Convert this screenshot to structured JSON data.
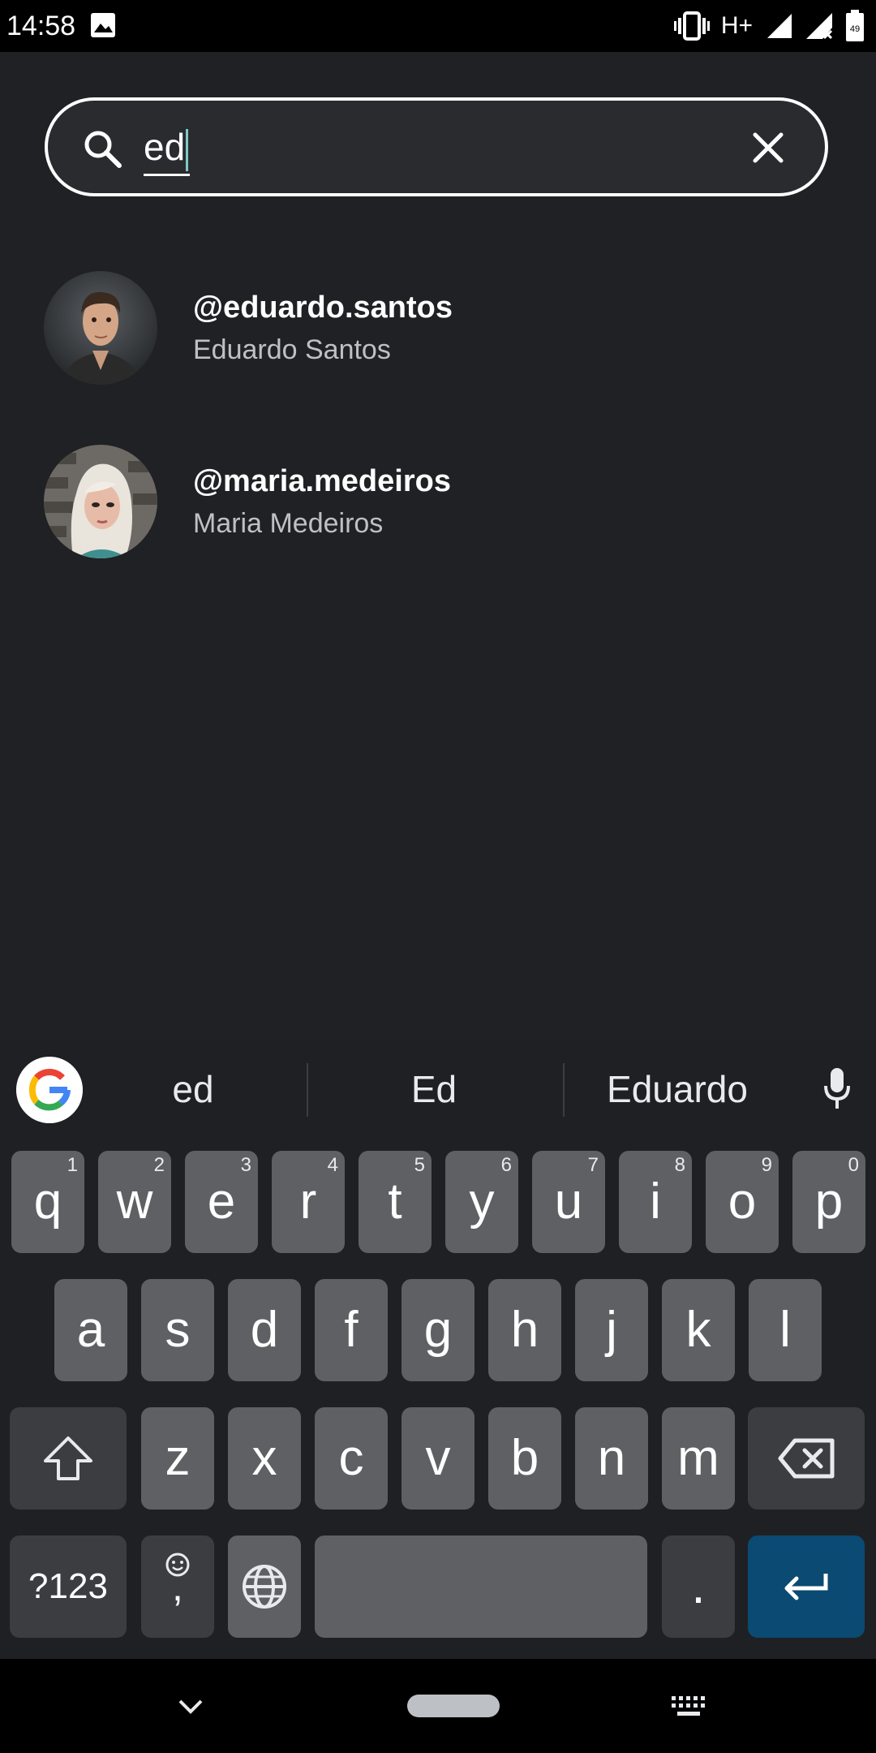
{
  "status_bar": {
    "time": "14:58",
    "network": "H+",
    "battery": "49",
    "icons": [
      "image-icon",
      "vibrate-icon",
      "signal-icon",
      "signal-no-data-icon",
      "battery-icon"
    ]
  },
  "search": {
    "query": "ed",
    "icons": {
      "search": "search-icon",
      "clear": "close-icon"
    }
  },
  "results": [
    {
      "handle": "@eduardo.santos",
      "name": "Eduardo Santos"
    },
    {
      "handle": "@maria.medeiros",
      "name": "Maria Medeiros"
    }
  ],
  "keyboard": {
    "suggestions": [
      "ed",
      "Ed",
      "Eduardo"
    ],
    "row1": [
      {
        "key": "q",
        "hint": "1"
      },
      {
        "key": "w",
        "hint": "2"
      },
      {
        "key": "e",
        "hint": "3"
      },
      {
        "key": "r",
        "hint": "4"
      },
      {
        "key": "t",
        "hint": "5"
      },
      {
        "key": "y",
        "hint": "6"
      },
      {
        "key": "u",
        "hint": "7"
      },
      {
        "key": "i",
        "hint": "8"
      },
      {
        "key": "o",
        "hint": "9"
      },
      {
        "key": "p",
        "hint": "0"
      }
    ],
    "row2": [
      "a",
      "s",
      "d",
      "f",
      "g",
      "h",
      "j",
      "k",
      "l"
    ],
    "row3": [
      "z",
      "x",
      "c",
      "v",
      "b",
      "n",
      "m"
    ],
    "symbols_label": "?123",
    "comma_label": ",",
    "period_label": "."
  },
  "colors": {
    "background": "#202124",
    "accent_enter": "#0b4a72",
    "caret": "#80cbc4"
  }
}
